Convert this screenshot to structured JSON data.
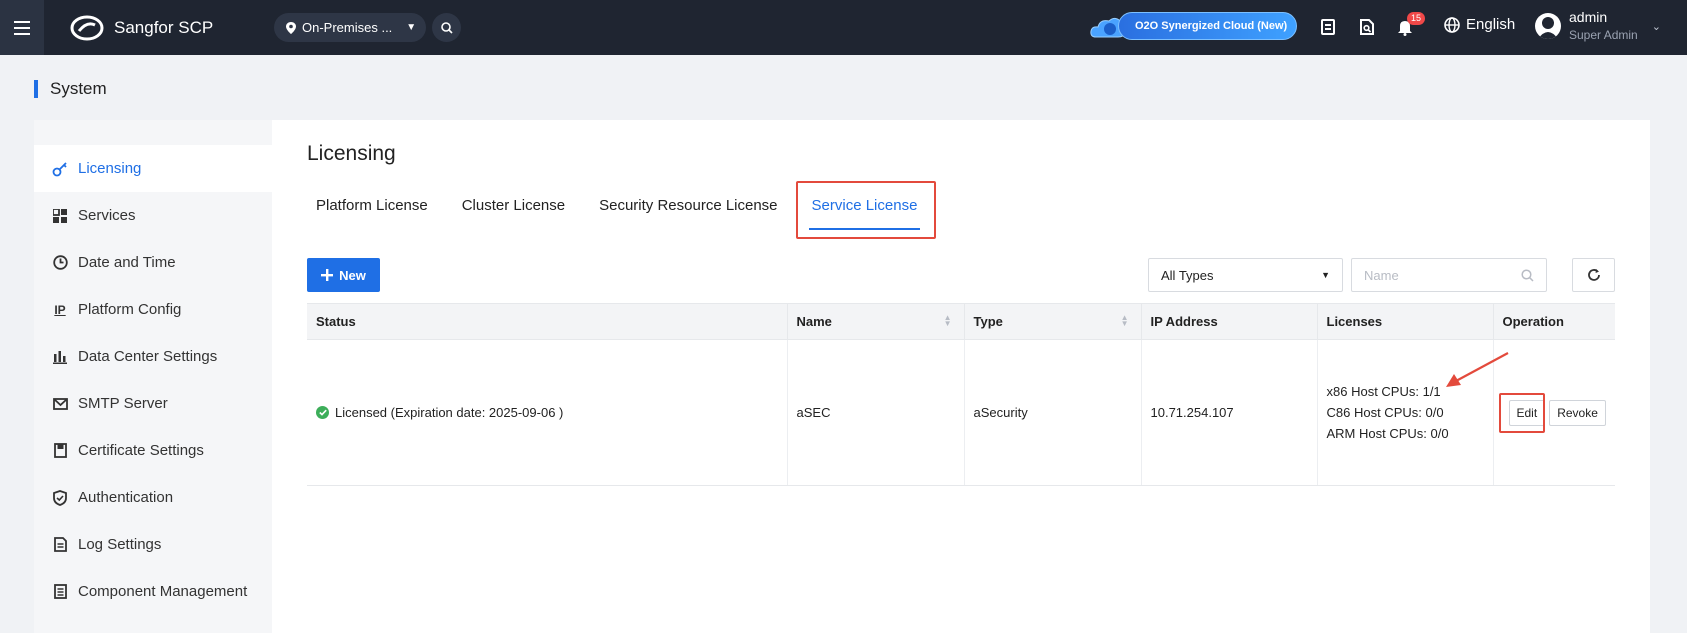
{
  "topbar": {
    "menu_icon": "hamburger-icon",
    "brand": "Sangfor SCP",
    "location": "On-Premises ...",
    "o2o_label": "O2O Synergized Cloud (New)",
    "notification_count": "15",
    "language": "English",
    "user_name": "admin",
    "user_role": "Super Admin"
  },
  "page": {
    "title": "System"
  },
  "sidebar": {
    "items": [
      {
        "label": "Licensing",
        "icon": "key-icon"
      },
      {
        "label": "Services",
        "icon": "grid-icon"
      },
      {
        "label": "Date and Time",
        "icon": "clock-icon"
      },
      {
        "label": "Platform Config",
        "icon": "ip-icon"
      },
      {
        "label": "Data Center Settings",
        "icon": "bar-chart-icon"
      },
      {
        "label": "SMTP Server",
        "icon": "mail-icon"
      },
      {
        "label": "Certificate Settings",
        "icon": "certificate-icon"
      },
      {
        "label": "Authentication",
        "icon": "shield-icon"
      },
      {
        "label": "Log Settings",
        "icon": "log-icon"
      },
      {
        "label": "Component Management",
        "icon": "list-icon"
      }
    ]
  },
  "main": {
    "title": "Licensing",
    "tabs": [
      {
        "label": "Platform License"
      },
      {
        "label": "Cluster License"
      },
      {
        "label": "Security Resource License"
      },
      {
        "label": "Service License"
      }
    ],
    "new_button": "New",
    "type_filter": "All Types",
    "name_placeholder": "Name",
    "table": {
      "headers": [
        "Status",
        "Name",
        "Type",
        "IP Address",
        "Licenses",
        "Operation"
      ],
      "rows": [
        {
          "status": "Licensed (Expiration date: 2025-09-06 )",
          "name": "aSEC",
          "type": "aSecurity",
          "ip": "10.71.254.107",
          "licenses": [
            "x86 Host CPUs: 1/1",
            "C86 Host CPUs: 0/0",
            "ARM Host CPUs: 0/0"
          ],
          "edit": "Edit",
          "revoke": "Revoke"
        }
      ]
    }
  },
  "colors": {
    "accent": "#1f6fe5",
    "topbar": "#1f2531",
    "highlight": "#e34a3c",
    "success": "#3dae5a"
  }
}
